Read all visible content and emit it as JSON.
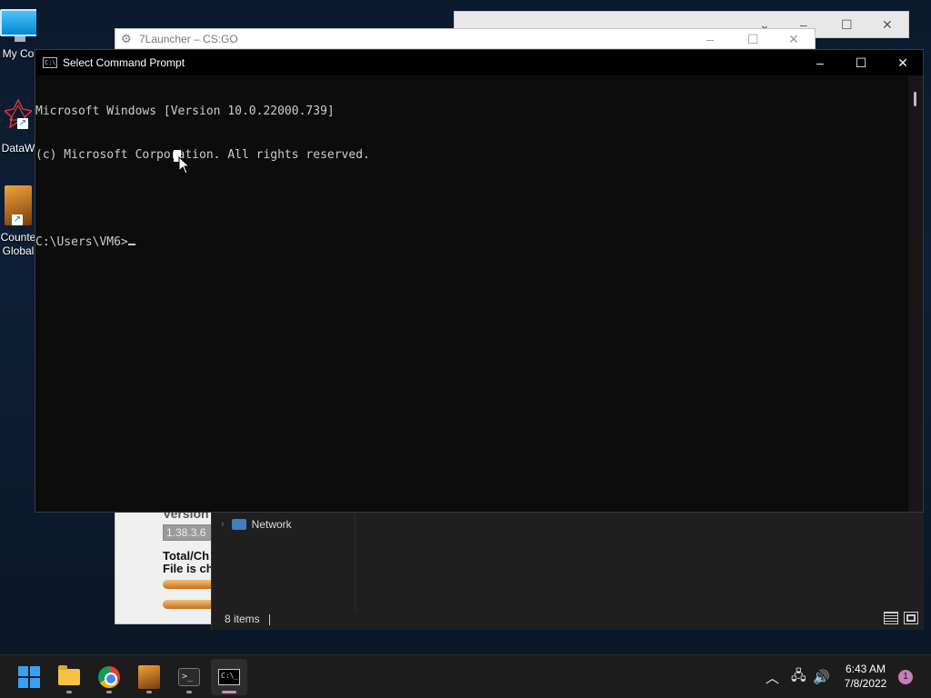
{
  "desktop": {
    "icons": [
      {
        "label": "My Co",
        "icon": "computer-icon"
      },
      {
        "label": "DataW",
        "icon": "datawarehouse-icon"
      },
      {
        "label": "Counte",
        "label2": "Global",
        "icon": "csgo-icon"
      }
    ]
  },
  "background_windows": {
    "launcher": {
      "title": "7Launcher – CS:GO",
      "version_heading": "Version",
      "version_value": "1.38.3.6",
      "total_line": "Total/Ch",
      "file_line": "File is ch"
    },
    "explorer": {
      "nav_item": "Network",
      "status": "8 items"
    }
  },
  "cmd": {
    "title": "Select Command Prompt",
    "lines": [
      "Microsoft Windows [Version 10.0.22000.739]",
      "(c) Microsoft Corporation. All rights reserved.",
      "",
      "C:\\Users\\VM6>"
    ]
  },
  "taskbar": {
    "apps": [
      {
        "name": "start",
        "icon": "windows-start-icon"
      },
      {
        "name": "file-explorer",
        "icon": "folder-icon"
      },
      {
        "name": "chrome",
        "icon": "chrome-icon"
      },
      {
        "name": "csgo",
        "icon": "csgo-icon"
      },
      {
        "name": "terminal",
        "icon": "terminal-icon"
      },
      {
        "name": "command-prompt",
        "icon": "cmd-icon",
        "active": true
      }
    ],
    "tray": {
      "time": "6:43 AM",
      "date": "7/8/2022",
      "notifications": "1"
    }
  },
  "colors": {
    "accent": "#3aa0f3",
    "console_bg": "#0c0c0c",
    "console_fg": "#cccccc",
    "active_indicator": "#d78ab8"
  }
}
